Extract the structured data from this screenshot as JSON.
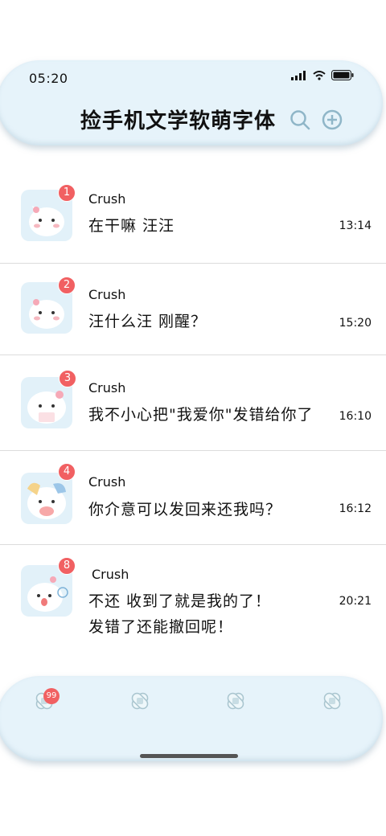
{
  "status_bar": {
    "time": "05:20"
  },
  "header": {
    "title": "捡手机文学软萌字体"
  },
  "colors": {
    "accent_bg": "#e6f3fa",
    "badge": "#f16062"
  },
  "conversations": [
    {
      "badge": "1",
      "name": "Crush",
      "message": "在干嘛 汪汪",
      "time": "13:14"
    },
    {
      "badge": "2",
      "name": "Crush",
      "message": "汪什么汪 刚醒？",
      "time": "15:20"
    },
    {
      "badge": "3",
      "name": "Crush",
      "message": "我不小心把\"我爱你\"发错给你了",
      "time": "16:10"
    },
    {
      "badge": "4",
      "name": "Crush",
      "message": "你介意可以发回来还我吗？",
      "time": "16:12"
    },
    {
      "badge": "8",
      "name": "Crush",
      "message": "不还 收到了就是我的了！",
      "message2": "发错了还能撤回呢！",
      "time": "20:21"
    }
  ],
  "tabbar": {
    "badge": "99",
    "icons": [
      "bandage-icon",
      "bandage-icon",
      "bandage-icon",
      "bandage-icon"
    ]
  }
}
